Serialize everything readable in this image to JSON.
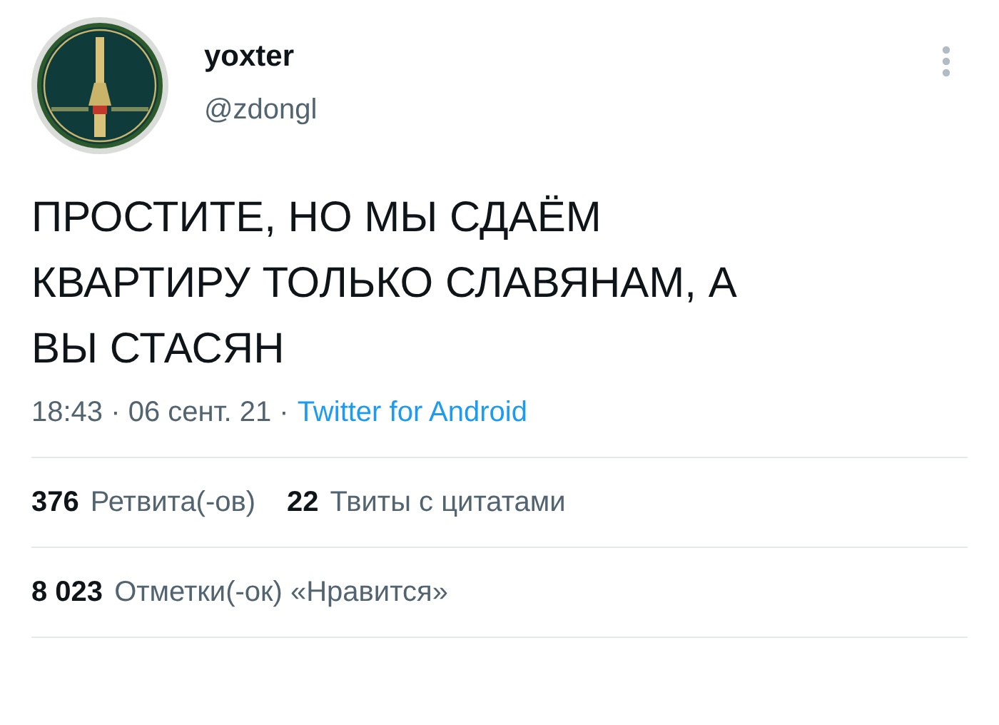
{
  "author": {
    "name": "yoxter",
    "handle": "@zdongl"
  },
  "tweet": {
    "text": "ПРОСТИТЕ, НО МЫ СДАЁМ КВАРТИРУ ТОЛЬКО СЛАВЯНАМ, А ВЫ СТАСЯН"
  },
  "meta": {
    "posted": "18:43 · 06 сент. 21 ·",
    "source": "Twitter for Android"
  },
  "stat_rows": [
    [
      {
        "count": "376",
        "label": "Ретвита(-ов)"
      },
      {
        "count": "22",
        "label": "Твиты с цитатами"
      }
    ],
    [
      {
        "count": "8 023",
        "label": "Отметки(-ок) «Нравится»"
      }
    ]
  ]
}
